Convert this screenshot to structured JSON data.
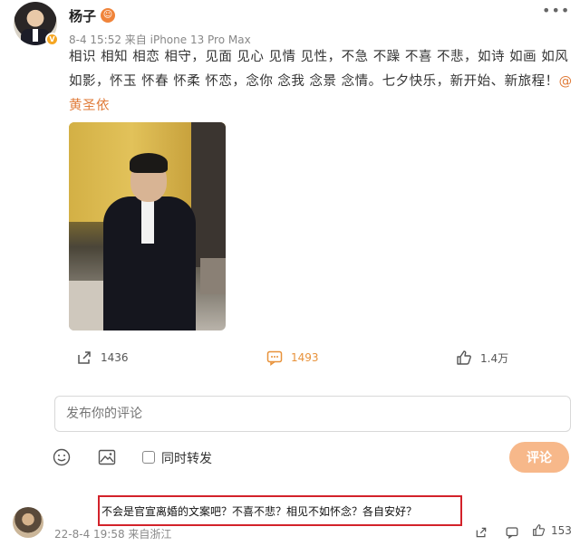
{
  "post": {
    "username": "杨子",
    "meta": "8-4 15:52  来自 iPhone 13 Pro Max",
    "text_main": "相识 相知 相恋 相守，见面 见心 见情 见性，不急 不躁 不喜 不悲，如诗 如画 如风 如影，怀玉 怀春 怀柔 怀恋，念你 念我 念景 念情。七夕快乐，新开始、新旅程！",
    "mention": "@黄圣依"
  },
  "actions": {
    "share_count": "1436",
    "comment_count": "1493",
    "like_count": "1.4万"
  },
  "compose": {
    "placeholder": "发布你的评论",
    "forward_label": "同时转发",
    "submit_label": "评论"
  },
  "reply": {
    "text": "不会是官宣离婚的文案吧？不喜不悲？相见不如怀念？各自安好？",
    "meta": "22-8-4 19:58 来自浙江",
    "like_count": "153"
  },
  "icons": {
    "more": "more-icon",
    "share": "share-icon",
    "comment": "comment-icon",
    "like": "thumbs-up-icon",
    "emoji": "emoji-icon",
    "image": "image-icon"
  },
  "colors": {
    "accent": "#e8923a",
    "mention": "#e07b39",
    "submit": "#f7b88a",
    "highlight": "#d3222a"
  }
}
